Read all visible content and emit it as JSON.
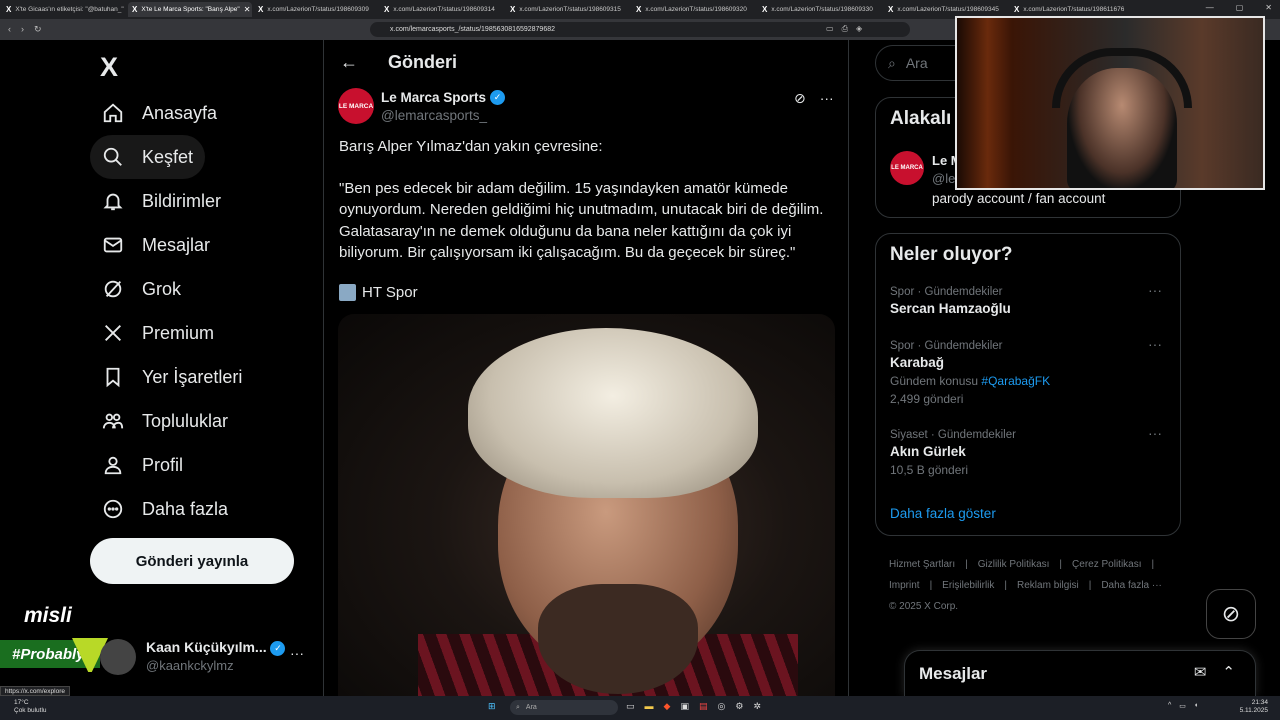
{
  "browser": {
    "tabs": [
      {
        "label": "X'te Gicaas'ın etiketçisi: \"@batuhan_\"",
        "active": false
      },
      {
        "label": "X'te Le Marca Sports: \"Barış Alpe\"",
        "active": true
      },
      {
        "label": "x.com/LazerionT/status/198609309",
        "active": false
      },
      {
        "label": "x.com/LazerionT/status/198609314",
        "active": false
      },
      {
        "label": "x.com/LazerionT/status/198609315",
        "active": false
      },
      {
        "label": "x.com/LazerionT/status/198609320",
        "active": false
      },
      {
        "label": "x.com/LazerionT/status/198609330",
        "active": false
      },
      {
        "label": "x.com/LazerionT/status/198609345",
        "active": false
      },
      {
        "label": "x.com/LazerionT/status/198611676",
        "active": false
      }
    ],
    "url": "x.com/lemarcasports_/status/1985630816592879682"
  },
  "sidebar": {
    "logo": "X",
    "items": [
      {
        "label": "Anasayfa",
        "icon": "home-icon"
      },
      {
        "label": "Keşfet",
        "icon": "search-icon"
      },
      {
        "label": "Bildirimler",
        "icon": "bell-icon"
      },
      {
        "label": "Mesajlar",
        "icon": "mail-icon"
      },
      {
        "label": "Grok",
        "icon": "grok-icon"
      },
      {
        "label": "Premium",
        "icon": "x-premium-icon"
      },
      {
        "label": "Yer İşaretleri",
        "icon": "bookmark-icon"
      },
      {
        "label": "Topluluklar",
        "icon": "communities-icon"
      },
      {
        "label": "Profil",
        "icon": "profile-icon"
      },
      {
        "label": "Daha fazla",
        "icon": "more-circle-icon"
      }
    ],
    "post_button": "Gönderi yayınla",
    "account": {
      "name": "Kaan Küçükyılm...",
      "handle": "@kaankckylmz"
    }
  },
  "overlay": {
    "misli": "misli",
    "probably": "#Probably"
  },
  "main": {
    "title": "Gönderi",
    "post": {
      "avatar_text": "LE MARCA",
      "author": "Le Marca Sports",
      "handle": "@lemarcasports_",
      "paragraph1": "Barış Alper Yılmaz'dan yakın çevresine:",
      "paragraph2": "\"Ben pes edecek bir adam değilim. 15 yaşındayken amatör kümede oynuyordum. Nereden geldiğimi hiç unutmadım, unutacak biri de değilim. Galatasaray'ın ne demek olduğunu da bana neler kattığını da çok iyi biliyorum. Bir çalışıyorsam iki çalışacağım. Bu da geçecek bir süreç.\"",
      "source": "HT Spor"
    }
  },
  "right": {
    "search_placeholder": "Ara",
    "related": {
      "title": "Alakalı",
      "avatar_text": "LE MARCA",
      "name": "Le M",
      "handle": "@le",
      "bio": "parody account / fan account"
    },
    "trends": {
      "title": "Neler oluyor?",
      "items": [
        {
          "category": "Spor · Gündemdekiler",
          "name": "Sercan Hamzaoğlu",
          "sub_prefix": "",
          "sub_tag": "",
          "count": ""
        },
        {
          "category": "Spor · Gündemdekiler",
          "name": "Karabağ",
          "sub_prefix": "Gündem konusu",
          "sub_tag": "#QarabağFK",
          "count": "2,499 gönderi"
        },
        {
          "category": "Siyaset · Gündemdekiler",
          "name": "Akın Gürlek",
          "sub_prefix": "",
          "sub_tag": "",
          "count": "10,5 B gönderi"
        }
      ],
      "show_more": "Daha fazla göster"
    },
    "footer": {
      "links": [
        "Hizmet Şartları",
        "|",
        "Gizlilik Politikası",
        "|",
        "Çerez Politikası",
        "|",
        "Imprint",
        "|",
        "Erişilebilirlik",
        "|",
        "Reklam bilgisi",
        "|",
        "Daha fazla ···"
      ],
      "copyright": "© 2025 X Corp."
    },
    "messages_title": "Mesajlar"
  },
  "status_url": "https://x.com/explore",
  "taskbar": {
    "weather_temp": "17°C",
    "weather_desc": "Çok bulutlu",
    "search": "Ara",
    "time": "21:34",
    "date": "5.11.2025"
  }
}
